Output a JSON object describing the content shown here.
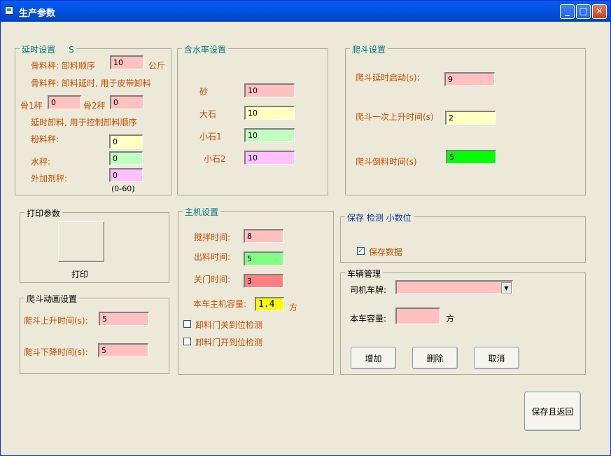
{
  "window": {
    "title": "生产参数",
    "minimize": "_",
    "maximize": "□",
    "close": "✕"
  },
  "delay": {
    "title": "延时设置",
    "unit_s": "S",
    "bone_label": "骨料秤: 卸料顺序",
    "bone_value": "10",
    "bone_unit": "公斤",
    "bone_note": "骨料秤: 卸料延时, 用于皮带卸料",
    "b1_label": "骨1秤",
    "b1_value": "0",
    "b2_label": "骨2秤",
    "b2_value": "0",
    "ctrl_note": "延时卸料, 用于控制卸料顺序",
    "powder_label": "粉料秤:",
    "powder_value": "0",
    "water_label": "水秤:",
    "water_value": "0",
    "additive_label": "外加剂秤:",
    "additive_value": "0",
    "range_hint": "(0-60)"
  },
  "moisture": {
    "title": "含水率设置",
    "sand_label": "砂",
    "sand_value": "10",
    "bigstone_label": "大石",
    "bigstone_value": "10",
    "small1_label": "小石1",
    "small1_value": "10",
    "small2_label": "小石2",
    "small2_value": "10"
  },
  "hopper": {
    "title": "爬斗设置",
    "delay_label": "爬斗延时启动(s):",
    "delay_value": "9",
    "rise_label": "爬斗一次上升时间(s)",
    "rise_value": "2",
    "dump_label": "爬斗倒料时间(s)",
    "dump_value": "5"
  },
  "print": {
    "title": "打印参数",
    "print_label": "打印"
  },
  "anim": {
    "title": "爬斗动画设置",
    "rise_label": "爬斗上升时间(s):",
    "rise_value": "5",
    "fall_label": "爬斗下降时间(s):",
    "fall_value": "5"
  },
  "main": {
    "title": "主机设置",
    "mix_label": "搅拌时间:",
    "mix_value": "8",
    "out_label": "出料时间:",
    "out_value": "5",
    "close_label": "关门时间:",
    "close_value": "3",
    "cap_label": "本车主机容量:",
    "cap_value": "1.4",
    "cap_unit": "方",
    "chk1_label": "卸料门关到位检测",
    "chk2_label": "卸料门开到位检测"
  },
  "save": {
    "title": "保存 检测  小数位",
    "chk_label": "保存数据"
  },
  "vehicle": {
    "title": "车辆管理",
    "plate_label": "司机车牌:",
    "plate_value": "",
    "cap_label": "本车容量:",
    "cap_value": "",
    "cap_unit": "方",
    "add_btn": "增加",
    "del_btn": "删除",
    "cancel_btn": "取消"
  },
  "footer": {
    "save_return": "保存且返回"
  },
  "colors": {
    "pink": "#ffc0c0",
    "yellow": "#ffffc0",
    "green": "#c0ffc0",
    "violet": "#ffc0ff",
    "bright_green": "#00ff00",
    "red": "#ff8080",
    "bright_yellow": "#ffff00"
  }
}
